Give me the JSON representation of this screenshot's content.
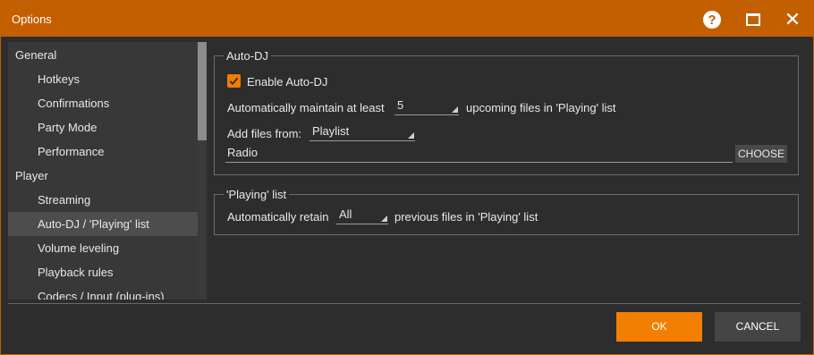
{
  "window": {
    "title": "Options"
  },
  "titlebar": {
    "help_glyph": "?",
    "close_glyph": "✕"
  },
  "sidebar": {
    "items": [
      {
        "label": "General",
        "type": "group"
      },
      {
        "label": "Hotkeys",
        "type": "sub"
      },
      {
        "label": "Confirmations",
        "type": "sub"
      },
      {
        "label": "Party Mode",
        "type": "sub"
      },
      {
        "label": "Performance",
        "type": "sub"
      },
      {
        "label": "Player",
        "type": "group"
      },
      {
        "label": "Streaming",
        "type": "sub"
      },
      {
        "label": "Auto-DJ / 'Playing' list",
        "type": "sub",
        "selected": true
      },
      {
        "label": "Volume leveling",
        "type": "sub"
      },
      {
        "label": "Playback rules",
        "type": "sub"
      },
      {
        "label": "Codecs / Input (plug-ins)",
        "type": "sub"
      }
    ]
  },
  "autodj": {
    "legend": "Auto-DJ",
    "enable_label": "Enable Auto-DJ",
    "enable_checked": true,
    "maintain_prefix": "Automatically maintain at least",
    "maintain_value": "5",
    "maintain_suffix": "upcoming files in 'Playing' list",
    "add_from_label": "Add files from:",
    "add_from_value": "Playlist",
    "source_value": "Radio",
    "choose_label": "CHOOSE"
  },
  "playing_list": {
    "legend": "'Playing' list",
    "retain_prefix": "Automatically retain",
    "retain_value": "All",
    "retain_suffix": "previous files in 'Playing' list"
  },
  "footer": {
    "ok_label": "OK",
    "cancel_label": "CANCEL"
  },
  "colors": {
    "titlebar": "#c45f00",
    "accent": "#f27f00",
    "background": "#2d2d2d"
  }
}
